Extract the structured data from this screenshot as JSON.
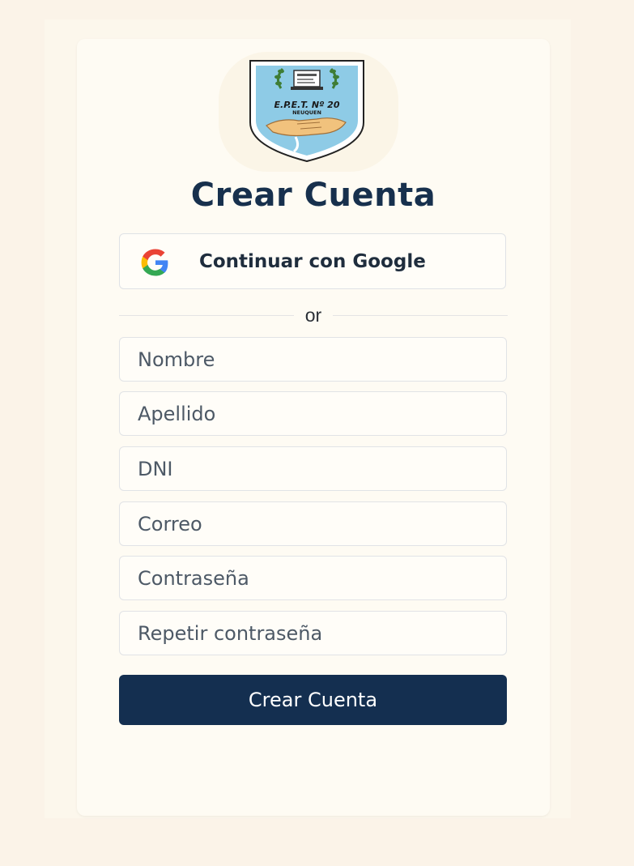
{
  "form": {
    "title": "Crear Cuenta",
    "google_button_label": "Continuar con Google",
    "divider_text": "or",
    "fields": [
      {
        "placeholder": "Nombre",
        "value": ""
      },
      {
        "placeholder": "Apellido",
        "value": ""
      },
      {
        "placeholder": "DNI",
        "value": ""
      },
      {
        "placeholder": "Correo",
        "value": ""
      },
      {
        "placeholder": "Contraseña",
        "value": ""
      },
      {
        "placeholder": "Repetir contraseña",
        "value": ""
      }
    ],
    "submit_label": "Crear Cuenta"
  },
  "logo": {
    "school_name": "E.P.E.T. Nº 20",
    "city": "NEUQUEN"
  },
  "icons": {
    "google": "google-g-icon"
  },
  "colors": {
    "page_background": "#fbf3e8",
    "card_background": "#fefbf3",
    "title_color": "#17304d",
    "submit_background": "#142f50",
    "logo_shield_blue": "#8ecbe6"
  }
}
